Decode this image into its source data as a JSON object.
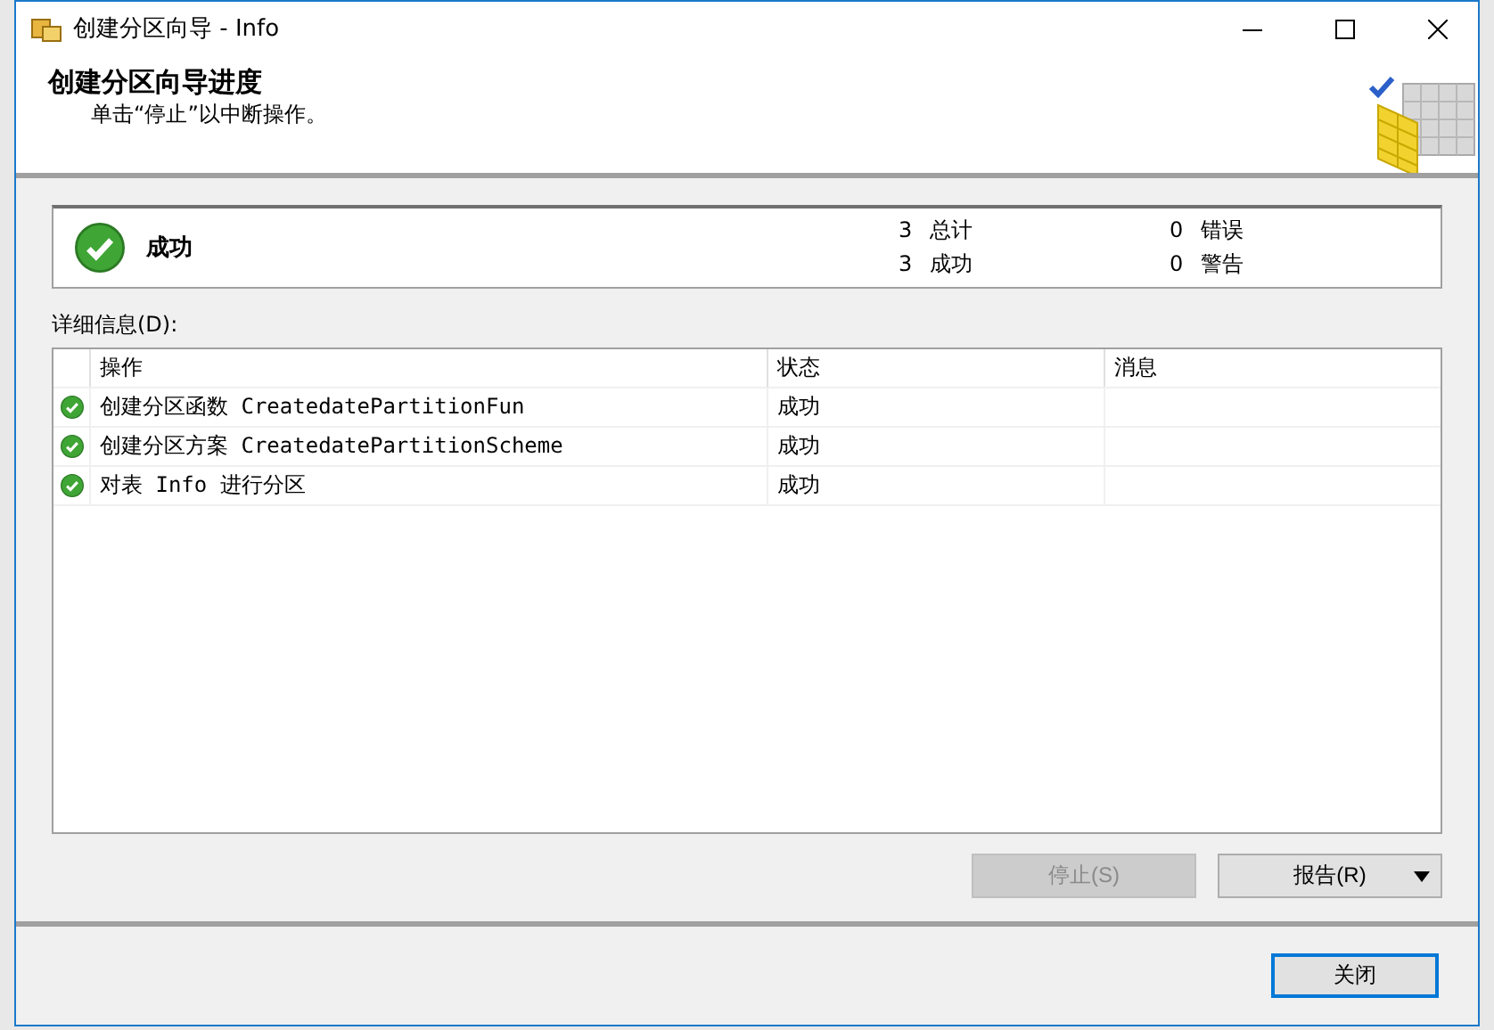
{
  "window": {
    "title": "创建分区向导 - Info"
  },
  "header": {
    "title": "创建分区向导进度",
    "subtitle": "单击“停止”以中断操作。"
  },
  "summary": {
    "status": "成功",
    "kind": "success",
    "counts": [
      "3 总计",
      "3 成功",
      "0 错误",
      "0 警告"
    ]
  },
  "details": {
    "label": "详细信息(D):",
    "columns": [
      "操作",
      "状态",
      "消息"
    ],
    "rows": [
      {
        "kind": "success",
        "action": "创建分区函数 CreatedatePartitionFun",
        "status": "成功"
      },
      {
        "kind": "success",
        "action": "创建分区方案 CreatedatePartitionScheme",
        "status": "成功"
      },
      {
        "kind": "success",
        "action": "对表 Info 进行分区",
        "status": "成功"
      }
    ]
  },
  "buttons": [
    {
      "label": "停止(S)",
      "disabled": true,
      "dropdown": false
    },
    {
      "label": "报告(R)",
      "disabled": false,
      "dropdown": true
    }
  ],
  "close": {
    "label": "关闭",
    "focused": true
  }
}
